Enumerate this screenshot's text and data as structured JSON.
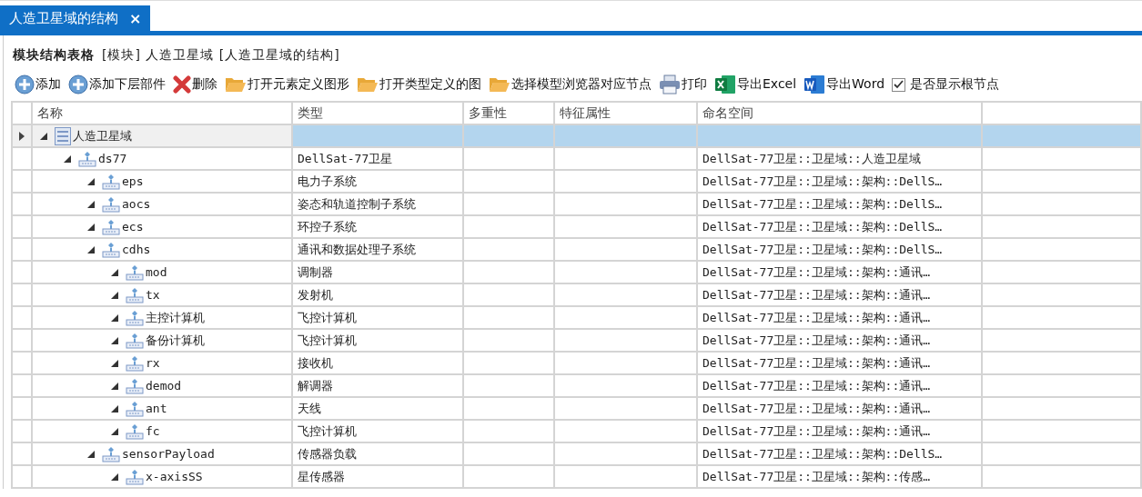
{
  "tab": {
    "title": "人造卫星域的结构",
    "close": "×",
    "selected": true
  },
  "heading": {
    "title": "模块结构表格",
    "subtitle": "[模块] 人造卫星域 [人造卫星域的结构]"
  },
  "toolbar": [
    {
      "kind": "add",
      "label": "添加"
    },
    {
      "kind": "add",
      "label": "添加下层部件"
    },
    {
      "kind": "delete",
      "label": "删除"
    },
    {
      "kind": "folder",
      "label": "打开元素定义图形"
    },
    {
      "kind": "folder",
      "label": "打开类型定义的图"
    },
    {
      "kind": "folder",
      "label": "选择模型浏览器对应节点"
    },
    {
      "kind": "print",
      "label": "打印"
    },
    {
      "kind": "excel",
      "label": "导出Excel"
    },
    {
      "kind": "word",
      "label": "导出Word"
    },
    {
      "kind": "checkbox",
      "label": "是否显示根节点",
      "checked": true
    }
  ],
  "table": {
    "columns": [
      "名称",
      "类型",
      "多重性",
      "特征属性",
      "命名空间"
    ],
    "rows": [
      {
        "kind": "package",
        "name": "人造卫星域",
        "type": "",
        "namespace": "",
        "selected": true,
        "expanded": true,
        "children": [
          {
            "kind": "part",
            "name": "ds77",
            "type": "DellSat-77卫星",
            "namespace": "DellSat-77卫星::卫星域::人造卫星域",
            "selected": false,
            "expanded": true,
            "children": [
              {
                "kind": "part",
                "name": "eps",
                "type": "电力子系统",
                "namespace": "DellSat-77卫星::卫星域::架构::DellS…",
                "selected": false,
                "expanded": true
              },
              {
                "kind": "part",
                "name": "aocs",
                "type": "姿态和轨道控制子系统",
                "namespace": "DellSat-77卫星::卫星域::架构::DellS…",
                "selected": false,
                "expanded": true
              },
              {
                "kind": "part",
                "name": "ecs",
                "type": "环控子系统",
                "namespace": "DellSat-77卫星::卫星域::架构::DellS…",
                "selected": false,
                "expanded": true
              },
              {
                "kind": "part",
                "name": "cdhs",
                "type": "通讯和数据处理子系统",
                "namespace": "DellSat-77卫星::卫星域::架构::DellS…",
                "selected": false,
                "expanded": true,
                "children": [
                  {
                    "kind": "part",
                    "name": "mod",
                    "type": "调制器",
                    "namespace": "DellSat-77卫星::卫星域::架构::通讯…",
                    "selected": false,
                    "expanded": true
                  },
                  {
                    "kind": "part",
                    "name": "tx",
                    "type": "发射机",
                    "namespace": "DellSat-77卫星::卫星域::架构::通讯…",
                    "selected": false,
                    "expanded": true
                  },
                  {
                    "kind": "part",
                    "name": "主控计算机",
                    "type": "飞控计算机",
                    "namespace": "DellSat-77卫星::卫星域::架构::通讯…",
                    "selected": false,
                    "expanded": true
                  },
                  {
                    "kind": "part",
                    "name": "备份计算机",
                    "type": "飞控计算机",
                    "namespace": "DellSat-77卫星::卫星域::架构::通讯…",
                    "selected": false,
                    "expanded": true
                  },
                  {
                    "kind": "part",
                    "name": "rx",
                    "type": "接收机",
                    "namespace": "DellSat-77卫星::卫星域::架构::通讯…",
                    "selected": false,
                    "expanded": true
                  },
                  {
                    "kind": "part",
                    "name": "demod",
                    "type": "解调器",
                    "namespace": "DellSat-77卫星::卫星域::架构::通讯…",
                    "selected": false,
                    "expanded": true
                  },
                  {
                    "kind": "part",
                    "name": "ant",
                    "type": "天线",
                    "namespace": "DellSat-77卫星::卫星域::架构::通讯…",
                    "selected": false,
                    "expanded": true
                  },
                  {
                    "kind": "part",
                    "name": "fc",
                    "type": "飞控计算机",
                    "namespace": "DellSat-77卫星::卫星域::架构::通讯…",
                    "selected": false,
                    "expanded": true
                  }
                ]
              },
              {
                "kind": "part",
                "name": "sensorPayload",
                "type": "传感器负载",
                "namespace": "DellSat-77卫星::卫星域::架构::DellS…",
                "selected": false,
                "expanded": true,
                "children": [
                  {
                    "kind": "part",
                    "name": "x-axisSS",
                    "type": "星传感器",
                    "namespace": "DellSat-77卫星::卫星域::架构::传感…",
                    "selected": false,
                    "expanded": true
                  }
                ]
              }
            ]
          }
        ]
      }
    ]
  }
}
